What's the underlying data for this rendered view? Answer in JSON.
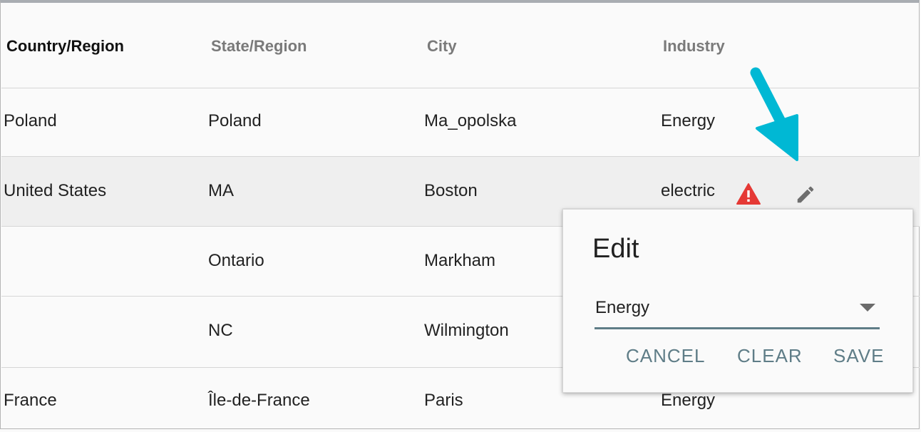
{
  "table": {
    "headers": [
      "Country/Region",
      "State/Region",
      "City",
      "Industry"
    ],
    "rows": [
      {
        "country": "Poland",
        "state": "Poland",
        "city": "Ma_opolska",
        "industry": "Energy"
      },
      {
        "country": "United States",
        "state": "MA",
        "city": "Boston",
        "industry": "electric"
      },
      {
        "country": "",
        "state": "Ontario",
        "city": "Markham",
        "industry": ""
      },
      {
        "country": "",
        "state": "NC",
        "city": "Wilmington",
        "industry": ""
      },
      {
        "country": "France",
        "state": "Île-de-France",
        "city": "Paris",
        "industry": "Energy"
      }
    ]
  },
  "row_icons": {
    "warning": "warning-triangle-icon",
    "edit": "pencil-icon"
  },
  "popup": {
    "title": "Edit",
    "select_value": "Energy",
    "cancel_label": "CANCEL",
    "clear_label": "CLEAR",
    "save_label": "SAVE"
  },
  "colors": {
    "accent": "#5f7d87",
    "warning": "#e53935",
    "callout_arrow": "#00b8d4",
    "selected_row": "#efefef"
  }
}
